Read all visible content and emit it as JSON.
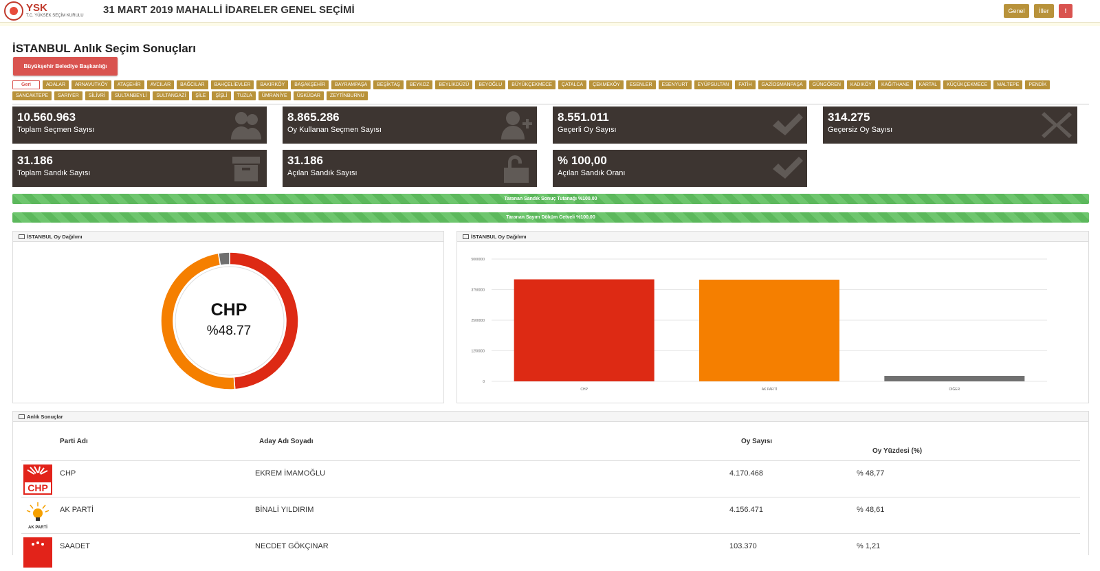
{
  "header": {
    "logo_text": "YSK",
    "logo_sub": "T.C. YÜKSEK SEÇİM KURULU",
    "title": "31 MART 2019 MAHALLİ İDARELER GENEL SEÇİMİ",
    "buttons": [
      "Genel",
      "İller",
      "!"
    ]
  },
  "page": {
    "title": "İSTANBUL Anlık Seçim Sonuçları",
    "election_type": "Büyükşehir Belediye Başkanlığı",
    "back_label": "Geri",
    "districts": [
      "ADALAR",
      "ARNAVUTKÖY",
      "ATAŞEHİR",
      "AVCILAR",
      "BAĞCILAR",
      "BAHÇELİEVLER",
      "BAKIRKÖY",
      "BAŞAKŞEHİR",
      "BAYRAMPAŞA",
      "BEŞİKTAŞ",
      "BEYKOZ",
      "BEYLİKDÜZÜ",
      "BEYOĞLU",
      "BÜYÜKÇEKMECE",
      "ÇATALCA",
      "ÇEKMEKÖY",
      "ESENLER",
      "ESENYURT",
      "EYÜPSULTAN",
      "FATİH",
      "GAZİOSMANPAŞA",
      "GÜNGÖREN",
      "KADIKÖY",
      "KAĞITHANE",
      "KARTAL",
      "KÜÇÜKÇEKMECE",
      "MALTEPE",
      "PENDİK",
      "SANCAKTEPE",
      "SARIYER",
      "SİLİVRİ",
      "SULTANBEYLİ",
      "SULTANGAZİ",
      "ŞİLE",
      "ŞİŞLİ",
      "TUZLA",
      "ÜMRANİYE",
      "ÜSKÜDAR",
      "ZEYTİNBURNU"
    ]
  },
  "stats": [
    {
      "value": "10.560.963",
      "label": "Toplam Seçmen Sayısı",
      "icon": "users-icon"
    },
    {
      "value": "8.865.286",
      "label": "Oy Kullanan Seçmen Sayısı",
      "icon": "user-plus-icon"
    },
    {
      "value": "8.551.011",
      "label": "Geçerli Oy Sayısı",
      "icon": "check-icon"
    },
    {
      "value": "314.275",
      "label": "Geçersiz Oy Sayısı",
      "icon": "x-icon"
    },
    {
      "value": "31.186",
      "label": "Toplam Sandık Sayısı",
      "icon": "archive-icon"
    },
    {
      "value": "31.186",
      "label": "Açılan Sandık Sayısı",
      "icon": "unlock-icon"
    },
    {
      "value": "% 100,00",
      "label": "Açılan Sandık Oranı",
      "icon": "check-icon"
    }
  ],
  "progress": [
    {
      "label": "Taranan Sandık Sonuç Tutanağı %100.00",
      "percent": 100
    },
    {
      "label": "Taranan Sayım Döküm Cetveli %100.00",
      "percent": 100
    }
  ],
  "donut_panel": {
    "title": "İSTANBUL Oy Dağılımı",
    "center_party": "CHP",
    "center_pct": "%48.77"
  },
  "bar_panel": {
    "title": "İSTANBUL Oy Dağılımı"
  },
  "chart_data": [
    {
      "type": "pie",
      "categories": [
        "CHP",
        "AK PARTİ",
        "DİĞER"
      ],
      "values": [
        48.77,
        48.61,
        2.62
      ],
      "colors": [
        "#dd2a14",
        "#f57f00",
        "#707070"
      ]
    },
    {
      "type": "bar",
      "categories": [
        "CHP",
        "AK PARTİ",
        "DİĞER"
      ],
      "values": [
        4170468,
        4156471,
        224072
      ],
      "colors": [
        "#dd2a14",
        "#f57f00",
        "#707070"
      ],
      "yticks": [
        "5000000",
        "3750000",
        "2500000",
        "1250000",
        "0"
      ],
      "ylim": [
        0,
        5000000
      ],
      "grid": true
    }
  ],
  "results": {
    "title": "Anlık Sonuçlar",
    "headers": {
      "party": "Parti Adı",
      "candidate": "Aday Adı Soyadı",
      "votes": "Oy Sayısı",
      "pct": "Oy Yüzdesi (%)"
    },
    "rows": [
      {
        "party": "CHP",
        "candidate": "EKREM İMAMOĞLU",
        "votes": "4.170.468",
        "pct": "% 48,77",
        "logo": "chp-logo"
      },
      {
        "party": "AK PARTİ",
        "candidate": "BİNALİ YILDIRIM",
        "votes": "4.156.471",
        "pct": "% 48,61",
        "logo": "akparti-logo"
      },
      {
        "party": "SAADET",
        "candidate": "NECDET GÖKÇINAR",
        "votes": "103.370",
        "pct": "% 1,21",
        "logo": "saadet-logo"
      }
    ]
  }
}
